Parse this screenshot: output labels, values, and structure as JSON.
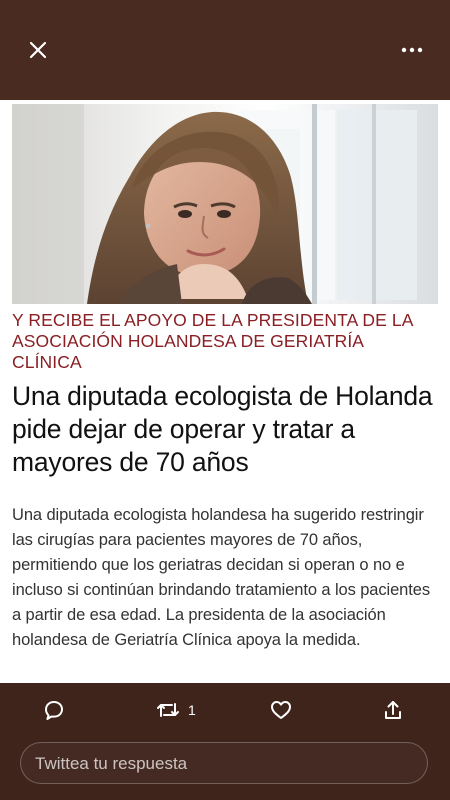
{
  "article": {
    "kicker": "Y RECIBE EL APOYO DE LA PRESIDENTA DE LA ASOCIACIÓN HOLANDESA DE GERIATRÍA CLÍNICA",
    "headline": "Una diputada ecologista de Holanda pide dejar de operar y tratar a mayores de 70 años",
    "body": "Una diputada ecologista holandesa ha sugerido restringir las cirugías para pacientes mayores de 70 años, permitiendo que los geriatras decidan si operan o no e incluso si continúan brindando tratamiento a los pacientes a partir de esa edad. La presidenta de la asociación holandesa de Geriatría Clínica apoya la medida."
  },
  "actions": {
    "retweet_count": "1"
  },
  "reply": {
    "placeholder": "Twittea tu respuesta"
  },
  "icons": {
    "close": "close-icon",
    "more": "more-icon",
    "reply": "reply-icon",
    "retweet": "retweet-icon",
    "like": "heart-icon",
    "share": "share-icon"
  },
  "colors": {
    "frame": "#4a2b22",
    "kicker": "#8a1f24",
    "headline": "#111111"
  }
}
